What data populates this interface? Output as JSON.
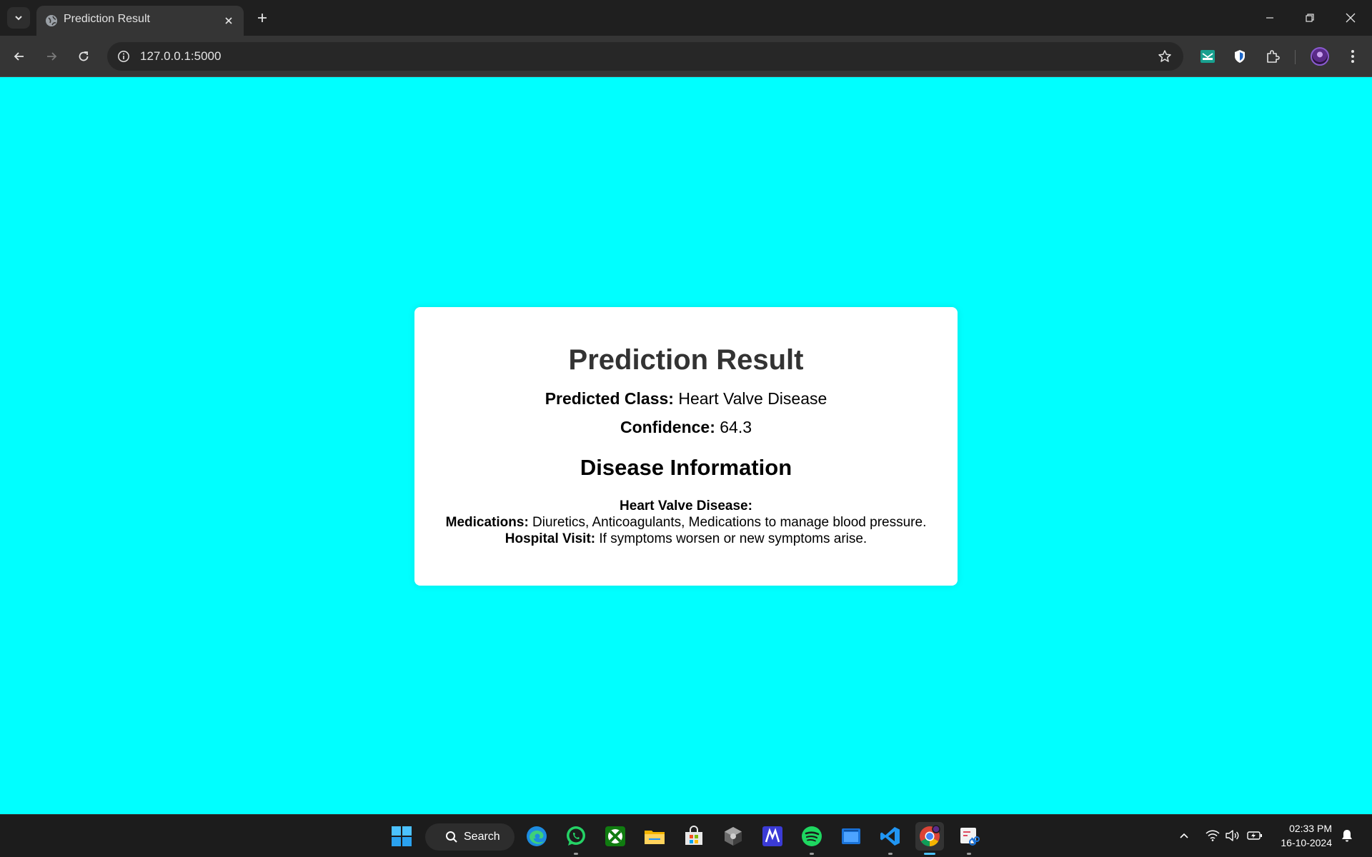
{
  "browser": {
    "tab_title": "Prediction Result",
    "url": "127.0.0.1:5000"
  },
  "result": {
    "title": "Prediction Result",
    "predicted_class_label": "Predicted Class:",
    "predicted_class_value": "Heart Valve Disease",
    "confidence_label": "Confidence:",
    "confidence_value": "64.3",
    "section_title": "Disease Information",
    "disease_name": "Heart Valve Disease:",
    "medications_label": "Medications:",
    "medications_value": "Diuretics, Anticoagulants, Medications to manage blood pressure.",
    "hospital_visit_label": "Hospital Visit:",
    "hospital_visit_value": "If symptoms worsen or new symptoms arise."
  },
  "taskbar": {
    "search_label": "Search",
    "time": "02:33 PM",
    "date": "16-10-2024"
  },
  "colors": {
    "page_background": "#00ffff",
    "card_background": "#ffffff",
    "title_color": "#333333"
  }
}
